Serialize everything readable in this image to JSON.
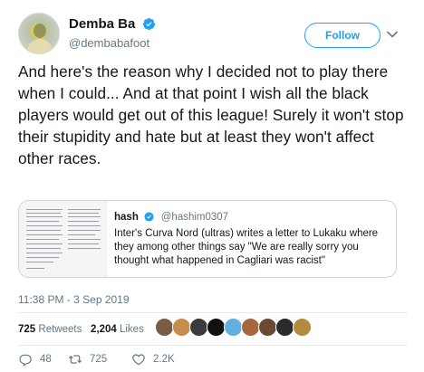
{
  "author": {
    "display_name": "Demba Ba",
    "handle": "@dembabafoot",
    "verified": true
  },
  "follow_label": "Follow",
  "tweet_text": "And here's the reason why I decided not to play there when I could... And at that point I wish all the black players would get out of this league! Surely it won't stop their stupidity and hate but at least they won't affect other races.",
  "quote": {
    "display_name": "hash",
    "handle": "@hashim0307",
    "verified": true,
    "text": "Inter's Curva Nord (ultras) writes a letter to Lukaku where they among other things say \"We are really sorry you thought what happened in Cagliari was racist\""
  },
  "timestamp": "11:38 PM - 3 Sep 2019",
  "stats": {
    "retweets_count": "725",
    "retweets_label": "Retweets",
    "likes_count": "2,204",
    "likes_label": "Likes"
  },
  "liker_colors": [
    "#7a5c44",
    "#c98c4f",
    "#3b3b3b",
    "#111111",
    "#5fb0e0",
    "#a5673f",
    "#6b4a35",
    "#2b2b2b",
    "#b48a3c"
  ],
  "actions": {
    "reply_count": "48",
    "retweet_count": "725",
    "like_count": "2.2K"
  },
  "colors": {
    "accent": "#1da1f2",
    "muted": "#657786",
    "text": "#14171a",
    "border": "#e6ecf0"
  }
}
